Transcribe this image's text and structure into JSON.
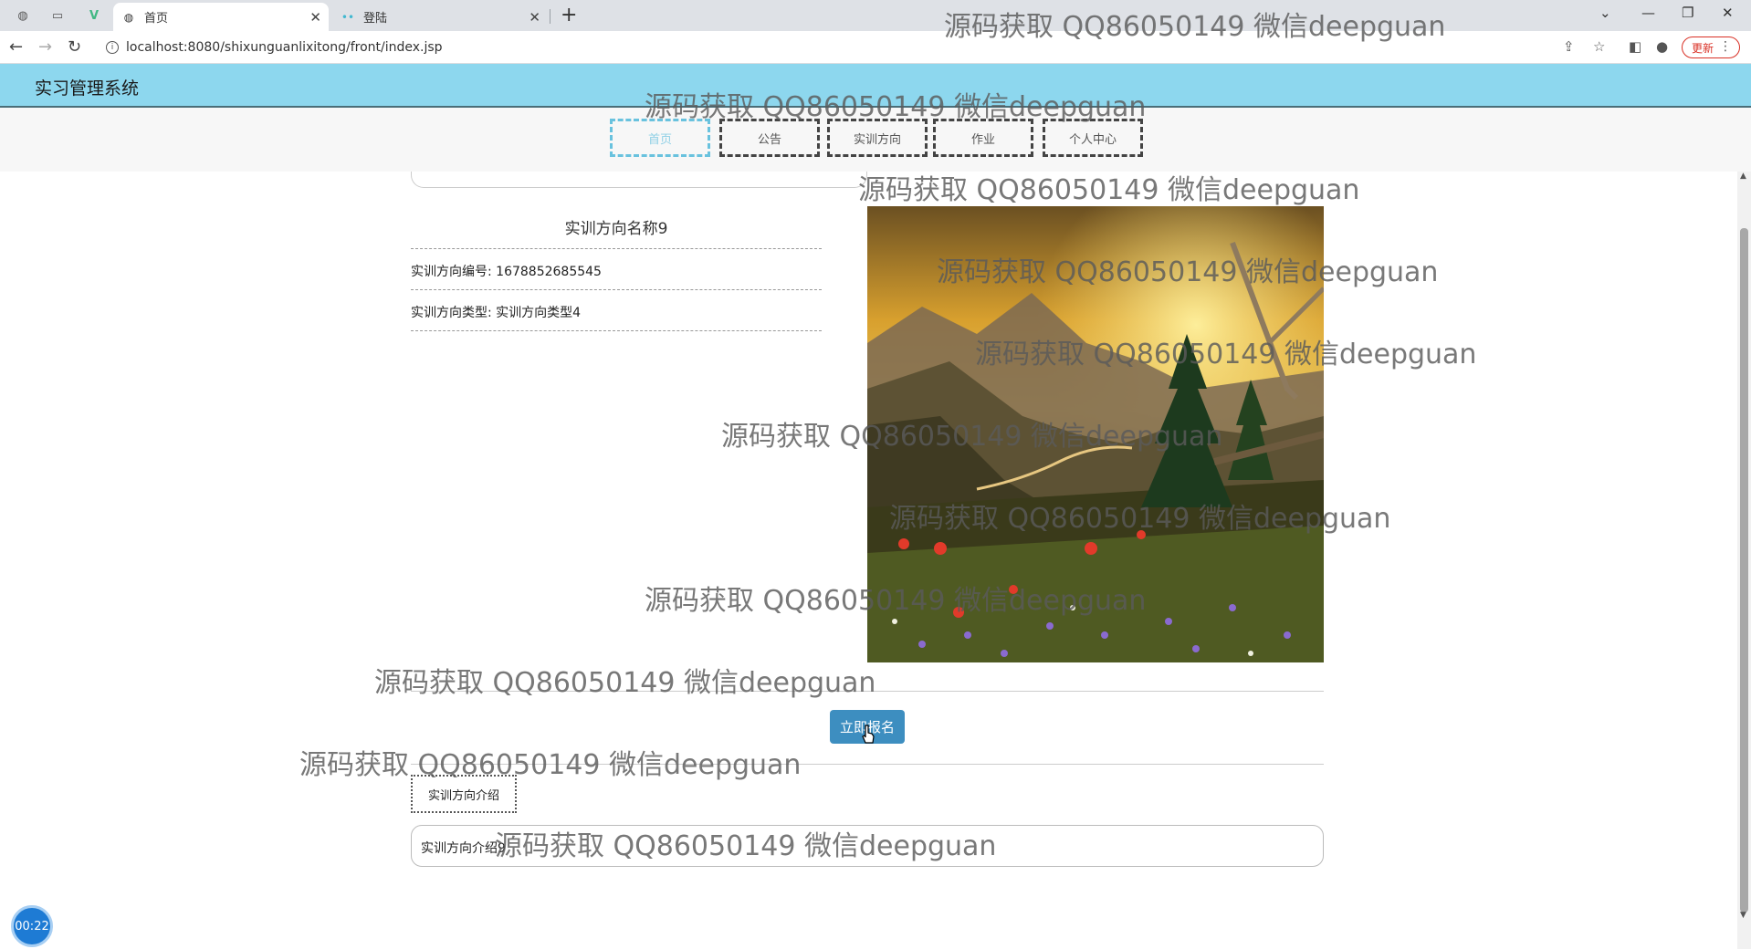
{
  "browser": {
    "tabs": [
      {
        "title": "首页",
        "active": true
      },
      {
        "title": "登陆",
        "active": false
      }
    ],
    "url": "localhost:8080/shixunguanlixitong/front/index.jsp",
    "update_label": "更新"
  },
  "site": {
    "title": "实习管理系统",
    "nav": [
      {
        "label": "首页",
        "active": true
      },
      {
        "label": "公告"
      },
      {
        "label": "实训方向"
      },
      {
        "label": "作业"
      },
      {
        "label": "个人中心"
      }
    ]
  },
  "detail": {
    "name": "实训方向名称9",
    "code_label": "实训方向编号:",
    "code_value": "1678852685545",
    "type_label": "实训方向类型:",
    "type_value": "实训方向类型4",
    "enroll_button": "立即报名",
    "intro_tab": "实训方向介绍",
    "intro_text": "实训方向介绍9"
  },
  "timer": "00:22",
  "watermark_text": "源码获取 QQ86050149 微信deepguan"
}
